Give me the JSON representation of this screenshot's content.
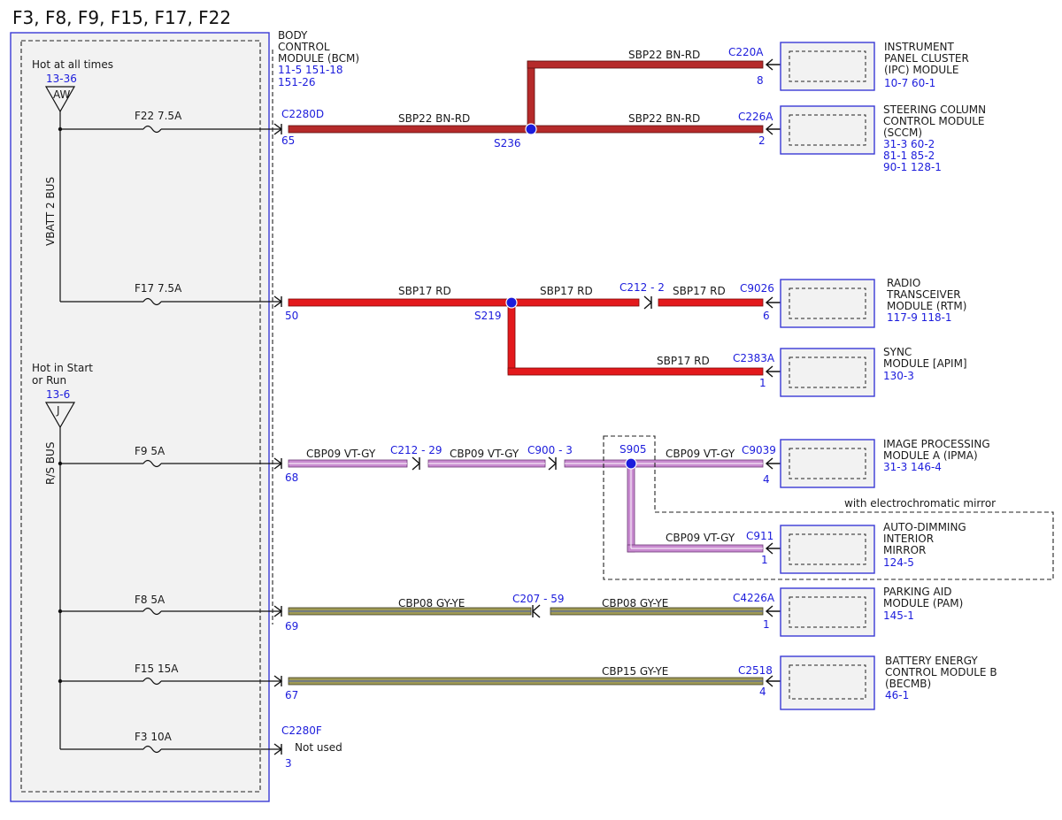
{
  "title": "F3, F8, F9, F15, F17, F22",
  "colors": {
    "brown_red": "#b52a2a",
    "red": "#e3191c",
    "violet_gray": "#c98bd0",
    "gray_yellow": "#9f9a55",
    "ref_blue": "#1c1cdc",
    "box_blue": "#3a3ad6"
  },
  "fuse_panel": {
    "hot_always": "Hot at all times",
    "hot_always_ref": "13-36",
    "triangle_aw": "AW",
    "vbatt_bus": "VBATT 2 BUS",
    "hot_start_line1": "Hot in Start",
    "hot_start_line2": "or Run",
    "hot_start_ref": "13-6",
    "triangle_j": "J",
    "rs_bus": "R/S BUS"
  },
  "fuses": [
    {
      "label": "F22  7.5A"
    },
    {
      "label": "F17  7.5A"
    },
    {
      "label": "F9    5A"
    },
    {
      "label": "F8    5A"
    },
    {
      "label": "F15  15A"
    },
    {
      "label": "F3    10A"
    }
  ],
  "bcm": {
    "line1": "BODY",
    "line2": "CONTROL",
    "line3": "MODULE (BCM)",
    "ref1": "11-5    151-18",
    "ref2": "151-26",
    "conn_d": "C2280D",
    "conn_f": "C2280F",
    "pins": [
      "65",
      "50",
      "68",
      "69",
      "67",
      "3"
    ],
    "not_used": "Not used"
  },
  "wires": {
    "sbp22": "SBP22  BN-RD",
    "sbp17": "SBP17  RD",
    "cbp09": "CBP09  VT-GY",
    "cbp08": "CBP08  GY-YE",
    "cbp15": "CBP15  GY-YE"
  },
  "splices": {
    "s236": "S236",
    "s219": "S219",
    "s905": "S905"
  },
  "inline_connectors": {
    "c212_2": "C212 - 2",
    "c212_29": "C212 - 29",
    "c900_3": "C900 - 3",
    "c207_59": "C207 - 59"
  },
  "option_note": "with electrochromatic mirror",
  "modules": [
    {
      "conn": "C220A",
      "pin": "8",
      "lines": [
        "INSTRUMENT",
        "PANEL CLUSTER",
        "(IPC) MODULE"
      ],
      "refs": [
        "10-7   60-1"
      ]
    },
    {
      "conn": "C226A",
      "pin": "2",
      "lines": [
        "STEERING COLUMN",
        "CONTROL MODULE",
        "(SCCM)"
      ],
      "refs": [
        "31-3   60-2",
        "81-1   85-2",
        "90-1   128-1"
      ]
    },
    {
      "conn": "C9026",
      "pin": "6",
      "lines": [
        "RADIO",
        "TRANSCEIVER",
        "MODULE (RTM)"
      ],
      "refs": [
        "117-9 118-1"
      ]
    },
    {
      "conn": "C2383A",
      "pin": "1",
      "lines": [
        "SYNC",
        "MODULE [APIM]"
      ],
      "refs": [
        "130-3"
      ]
    },
    {
      "conn": "C9039",
      "pin": "4",
      "lines": [
        "IMAGE PROCESSING",
        "MODULE A (IPMA)"
      ],
      "refs": [
        "31-3   146-4"
      ]
    },
    {
      "conn": "C911",
      "pin": "1",
      "lines": [
        "AUTO-DIMMING",
        "INTERIOR",
        "MIRROR"
      ],
      "refs": [
        "124-5"
      ]
    },
    {
      "conn": "C4226A",
      "pin": "1",
      "lines": [
        "PARKING AID",
        "MODULE (PAM)"
      ],
      "refs": [
        "145-1"
      ]
    },
    {
      "conn": "C2518",
      "pin": "4",
      "lines": [
        "BATTERY ENERGY",
        "CONTROL MODULE B",
        "(BECMB)"
      ],
      "refs": [
        "46-1"
      ]
    }
  ]
}
